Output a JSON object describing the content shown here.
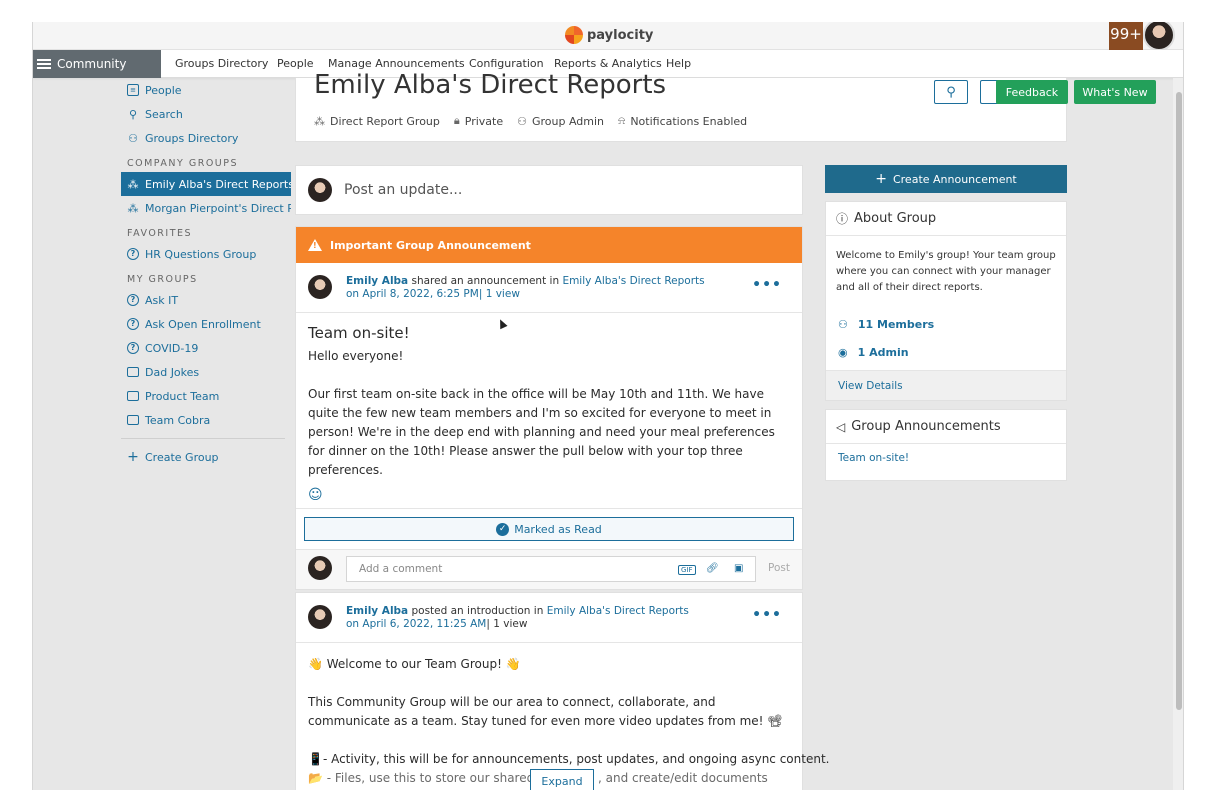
{
  "app": {
    "logo_text": "paylocity",
    "notification_count": "99+"
  },
  "nav": {
    "community_label": "Community",
    "items": [
      {
        "label": "Groups Directory"
      },
      {
        "label": "People"
      },
      {
        "label": "Manage Announcements"
      },
      {
        "label": "Configuration"
      },
      {
        "label": "Reports & Analytics"
      },
      {
        "label": "Help"
      }
    ]
  },
  "sidebar": {
    "top_items": [
      {
        "label": "People",
        "icon": "people-icon"
      },
      {
        "label": "Search",
        "icon": "search-icon"
      },
      {
        "label": "Groups Directory",
        "icon": "groups-icon"
      }
    ],
    "company_heading": "COMPANY GROUPS",
    "company_groups": [
      {
        "label": "Emily Alba's Direct Reports..",
        "active": true
      },
      {
        "label": "Morgan Pierpoint's Direct R",
        "active": false
      }
    ],
    "favorites_heading": "FAVORITES",
    "favorites": [
      {
        "label": "HR Questions Group"
      }
    ],
    "my_groups_heading": "MY GROUPS",
    "my_groups": [
      {
        "label": "Ask IT",
        "icon": "question-icon"
      },
      {
        "label": "Ask Open Enrollment",
        "icon": "question-icon"
      },
      {
        "label": "COVID-19",
        "icon": "question-icon"
      },
      {
        "label": "Dad Jokes",
        "icon": "chat-icon"
      },
      {
        "label": "Product Team",
        "icon": "chat-icon"
      },
      {
        "label": "Team Cobra",
        "icon": "chat-icon"
      }
    ],
    "create_group_label": "Create Group"
  },
  "group": {
    "title": "Emily Alba's Direct Reports",
    "meta": {
      "type": "Direct Report Group",
      "privacy": "Private",
      "role": "Group Admin",
      "notifications": "Notifications Enabled"
    }
  },
  "buttons": {
    "feedback": "Feedback",
    "whats_new": "What's New",
    "create_announcement": "Create Announcement"
  },
  "composer": {
    "placeholder": "Post an update..."
  },
  "announcement_post": {
    "banner": "Important Group Announcement",
    "author": "Emily Alba",
    "action": " shared an announcement in ",
    "group_link": "Emily Alba's Direct Reports",
    "date": "on April 8, 2022, 6:25 PM",
    "views": "| 1 view",
    "title": "Team on-site!",
    "greeting": "Hello everyone!",
    "body": "Our first team on-site back in the office will be May 10th and 11th. We have quite the few new team members and I'm so excited for everyone to meet in person! We're in the deep end with planning and need your meal preferences for dinner on the 10th! Please answer the pull below with your top three preferences.",
    "marked_read": "Marked as Read",
    "comment_placeholder": "Add a comment",
    "gif_label": "GIF",
    "post_label": "Post"
  },
  "intro_post": {
    "author": "Emily Alba",
    "action": " posted an introduction in ",
    "group_link": "Emily Alba's Direct Reports",
    "date": "on April 6, 2022, 11:25 AM",
    "views": "| 1 view",
    "welcome": "👋 Welcome to our Team Group! 👋",
    "body": "This Community Group will be our area to connect, collaborate, and communicate as a team. Stay tuned for even more video updates from me! 📽",
    "activity": "📱- Activity, this will be for announcements, post updates, and ongoing async content.",
    "files_start": "📂 - Files, use this to store our shared",
    "files_end": ", and create/edit documents",
    "expand_label": "Expand"
  },
  "about": {
    "heading": "About Group",
    "description": "Welcome to Emily's group! Your team group where you can connect with your manager and all of their direct reports.",
    "members": "11 Members",
    "admins": "1 Admin",
    "view_details": "View Details"
  },
  "group_announcements": {
    "heading": "Group Announcements",
    "items": [
      {
        "label": "Team on-site!"
      }
    ]
  },
  "colors": {
    "primary": "#1c6e9b",
    "announce_orange": "#f5842a",
    "success_green": "#23a05a",
    "nav_gray": "#616a70"
  }
}
